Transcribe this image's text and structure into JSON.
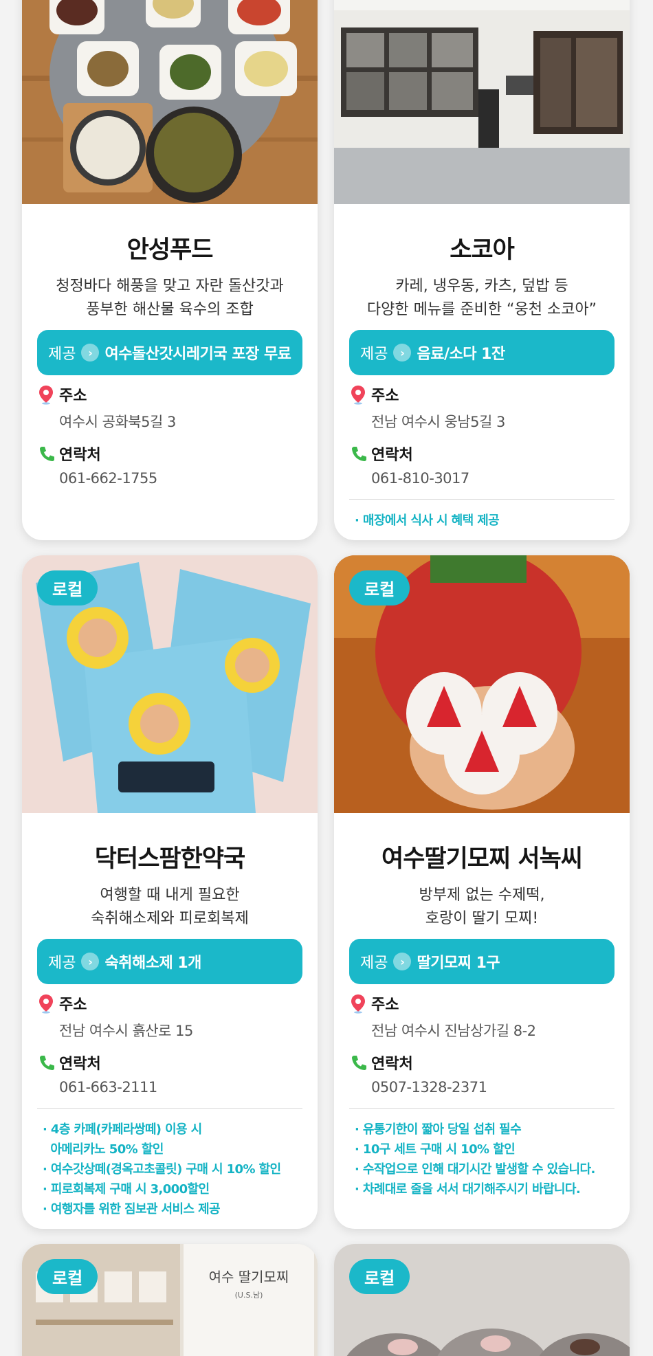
{
  "cards": [
    {
      "badge": "",
      "name": "안성푸드",
      "desc": [
        "청정바다 해풍을 맞고 자란 돌산갓과",
        "풍부한 해산물 육수의 조합"
      ],
      "offer_label": "제공",
      "offer_value": "여수돌산갓시레기국 포장 무료",
      "address_label": "주소",
      "address": "여수시 공화북5길 3",
      "phone_label": "연락처",
      "phone": "061-662-1755",
      "notes": []
    },
    {
      "badge": "",
      "name": "소코아",
      "desc": [
        "카레, 냉우동, 카츠, 덮밥 등",
        "다양한 메뉴를 준비한 “웅천 소코아”"
      ],
      "offer_label": "제공",
      "offer_value": "음료/소다 1잔",
      "address_label": "주소",
      "address": "전남 여수시 웅남5길 3",
      "phone_label": "연락처",
      "phone": "061-810-3017",
      "notes": [
        "· 매장에서 식사 시 혜택 제공"
      ]
    },
    {
      "badge": "로컬",
      "name": "닥터스팜한약국",
      "desc": [
        "여행할 때 내게 필요한",
        "숙취해소제와 피로회복제"
      ],
      "offer_label": "제공",
      "offer_value": "숙취해소제 1개",
      "address_label": "주소",
      "address": "전남 여수시 흙산로 15",
      "phone_label": "연락처",
      "phone": "061-663-2111",
      "notes": [
        "· 4층 카페(카페라쌍떼) 이용 시",
        "  아메리카노 50% 할인",
        "· 여수갓상떼(경옥고초콜릿) 구매 시 10% 할인",
        "· 피로회복제 구매 시 3,000할인",
        "· 여행자를 위한 짐보관 서비스 제공"
      ]
    },
    {
      "badge": "로컬",
      "name": "여수딸기모찌 서녹씨",
      "desc": [
        "방부제 없는 수제떡,",
        "호랑이 딸기 모찌!"
      ],
      "offer_label": "제공",
      "offer_value": "딸기모찌 1구",
      "address_label": "주소",
      "address": "전남 여수시 진남상가길 8-2",
      "phone_label": "연락처",
      "phone": "0507-1328-2371",
      "notes": [
        "· 유통기한이 짧아 당일 섭취 필수",
        "· 10구 세트 구매 시 10% 할인",
        "· 수작업으로 인해 대기시간 발생할 수 있습니다.",
        "· 차례대로 줄을 서서 대기해주시기 바랍니다."
      ]
    },
    {
      "badge": "로컬",
      "sign": "여수 딸기모찌",
      "sign_sub": "(U.S.남)"
    },
    {
      "badge": "로컬"
    }
  ],
  "colors": {
    "accent": "#1bb8c9",
    "note": "#14b3c4"
  },
  "icons": {
    "address": "map-pin-icon",
    "phone": "phone-icon"
  }
}
